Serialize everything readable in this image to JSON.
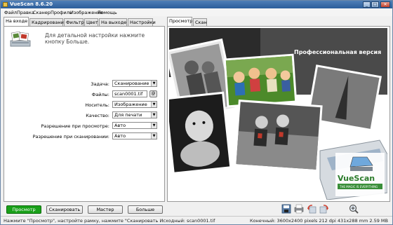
{
  "window": {
    "title": "VueScan 8.6.20",
    "controls": [
      "_",
      "□",
      "✕"
    ]
  },
  "menu": [
    "Файл",
    "Правка",
    "Сканер",
    "Профиль",
    "Изображение",
    "Помощь"
  ],
  "left_tabs": [
    "На входе",
    "Кадрирование",
    "Фильтр",
    "Цвет",
    "На выходе",
    "Настройки"
  ],
  "left_active_tab": "На входе",
  "hint": "Для детальной настройки нажмите кнопку Больше.",
  "settings": {
    "task": {
      "label": "Задача:",
      "value": "Сканирование в ф"
    },
    "files": {
      "label": "Файлы:",
      "value": "scan0001.tif",
      "button": "@"
    },
    "media": {
      "label": "Носитель:",
      "value": "Изображение"
    },
    "quality": {
      "label": "Качество:",
      "value": "Для печати"
    },
    "preview_res": {
      "label": "Разрешение при просмотре:",
      "value": "Авто"
    },
    "scan_res": {
      "label": "Разрешение при сканировании:",
      "value": "Авто"
    }
  },
  "right_tabs": [
    "Просмотр",
    "Скан"
  ],
  "right_active_tab": "Просмотр",
  "preview": {
    "banner": "Профессиональная версия",
    "logo_text": "VueScan",
    "logo_tagline": "THE MAGIC IS EVERYTHING"
  },
  "buttons": {
    "preview": "Просмотр",
    "scan": "Сканировать",
    "wizard": "Мастер",
    "more": "Больше"
  },
  "toolbar_icons": [
    "save-icon",
    "print-icon",
    "rotate-left-icon",
    "rotate-right-icon",
    "zoom-in-icon"
  ],
  "status": {
    "left": "Нажмите \"Просмотр\", настройте рамку, нажмите \"Сканировать Исходный: scan0001.tif",
    "right": "Конечный: 3600x2400 pixels 212 dpi 431x288 mm 2.59 MB"
  },
  "colors": {
    "accent": "#2c5d9a",
    "primary_button": "#19a019",
    "banner_text": "#ffffff"
  }
}
